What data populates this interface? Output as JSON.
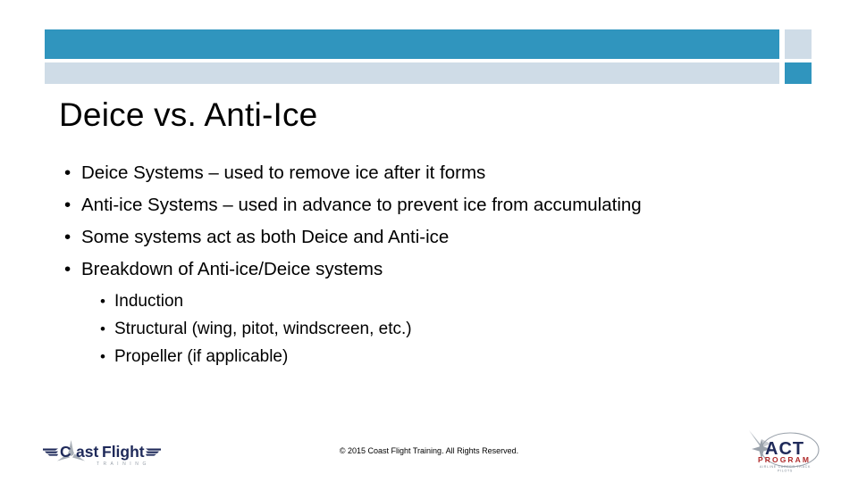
{
  "slide": {
    "title": "Deice vs. Anti-Ice",
    "bullets": [
      {
        "text": "Deice Systems – used to remove ice after it forms"
      },
      {
        "text": "Anti-ice Systems – used in advance to prevent ice from accumulating"
      },
      {
        "text": "Some systems act as both Deice and Anti-ice"
      },
      {
        "text": "Breakdown of Anti-ice/Deice systems",
        "sub_bullets": [
          "Induction",
          "Structural (wing, pitot, windscreen, etc.)",
          "Propeller (if applicable)"
        ]
      }
    ],
    "bullet_glyph": "•",
    "footer": "© 2015 Coast Flight Training. All Rights Reserved."
  },
  "logos": {
    "coast_flight": {
      "name": "coast-flight-training-logo",
      "word_coast": "C",
      "word_oast": "ast",
      "word_flight": "Flight",
      "tagline": "T R A I N I N G"
    },
    "act": {
      "name": "act-program-logo",
      "acronym": "ACT",
      "program": "PROGRAM",
      "tagline_line1": "AIRLINE CAREER TRACK",
      "tagline_line2": "PILOTS"
    }
  },
  "colors": {
    "accent_blue": "#3095be",
    "light_blue": "#cfdce7",
    "text_black": "#000000",
    "logo_navy": "#1f2a5a",
    "logo_gray": "#9aa2ab",
    "logo_red": "#b02a2a",
    "background": "#ffffff"
  }
}
